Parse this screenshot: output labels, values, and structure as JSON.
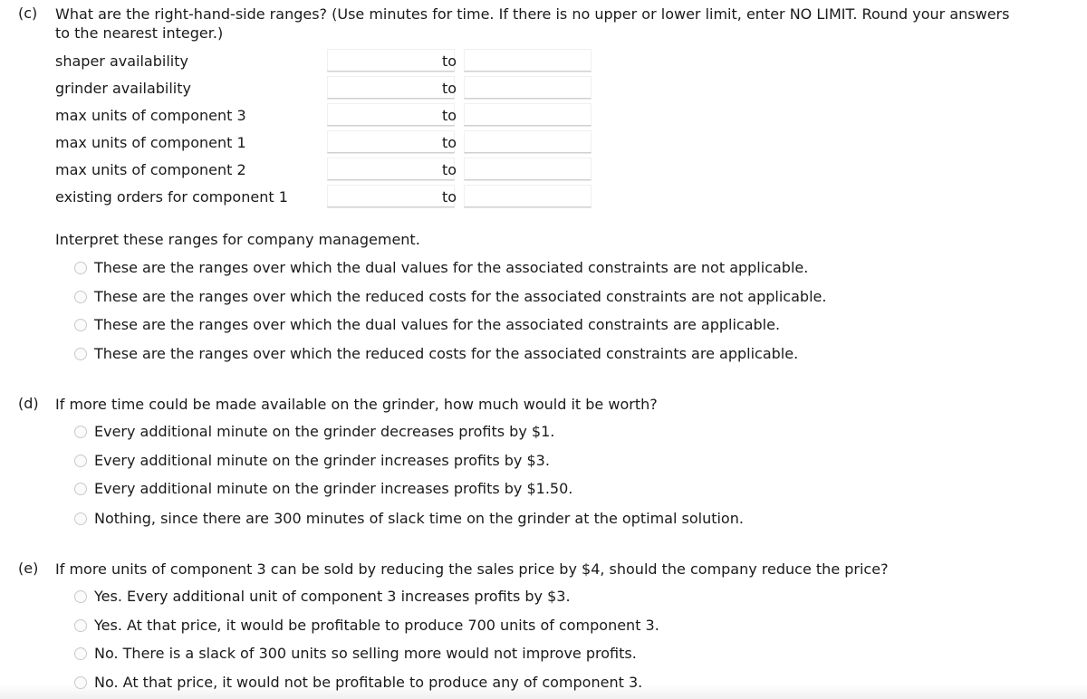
{
  "part_c": {
    "letter": "(c)",
    "question_line1": "What are the right-hand-side ranges? (Use minutes for time. If there is no upper or lower limit, enter NO LIMIT. Round your answers",
    "question_line2": "to the nearest integer.)",
    "ranges": [
      {
        "label": "shaper availability",
        "lower": "",
        "upper": "",
        "to": "to"
      },
      {
        "label": "grinder availability",
        "lower": "",
        "upper": "",
        "to": "to"
      },
      {
        "label": "max units of component 3",
        "lower": "",
        "upper": "",
        "to": "to"
      },
      {
        "label": "max units of component 1",
        "lower": "",
        "upper": "",
        "to": "to"
      },
      {
        "label": "max units of component 2",
        "lower": "",
        "upper": "",
        "to": "to"
      },
      {
        "label": "existing orders for component 1",
        "lower": "",
        "upper": "",
        "to": "to"
      }
    ],
    "interpret_prompt": "Interpret these ranges for company management.",
    "options": [
      "These are the ranges over which the dual values for the associated constraints are not applicable.",
      "These are the ranges over which the reduced costs for the associated constraints are not applicable.",
      "These are the ranges over which the dual values for the associated constraints are applicable.",
      "These are the ranges over which the reduced costs for the associated constraints are applicable."
    ]
  },
  "part_d": {
    "letter": "(d)",
    "question": "If more time could be made available on the grinder, how much would it be worth?",
    "options": [
      "Every additional minute on the grinder decreases profits by $1.",
      "Every additional minute on the grinder increases profits by $3.",
      "Every additional minute on the grinder increases profits by $1.50.",
      "Nothing, since there are 300 minutes of slack time on the grinder at the optimal solution."
    ]
  },
  "part_e": {
    "letter": "(e)",
    "question": "If more units of component 3 can be sold by reducing the sales price by $4, should the company reduce the price?",
    "options": [
      "Yes. Every additional unit of component 3 increases profits by $3.",
      "Yes. At that price, it would be profitable to produce 700 units of component 3.",
      "No. There is a slack of 300 units so selling more would not improve profits.",
      "No. At that price, it would not be profitable to produce any of component 3."
    ]
  }
}
